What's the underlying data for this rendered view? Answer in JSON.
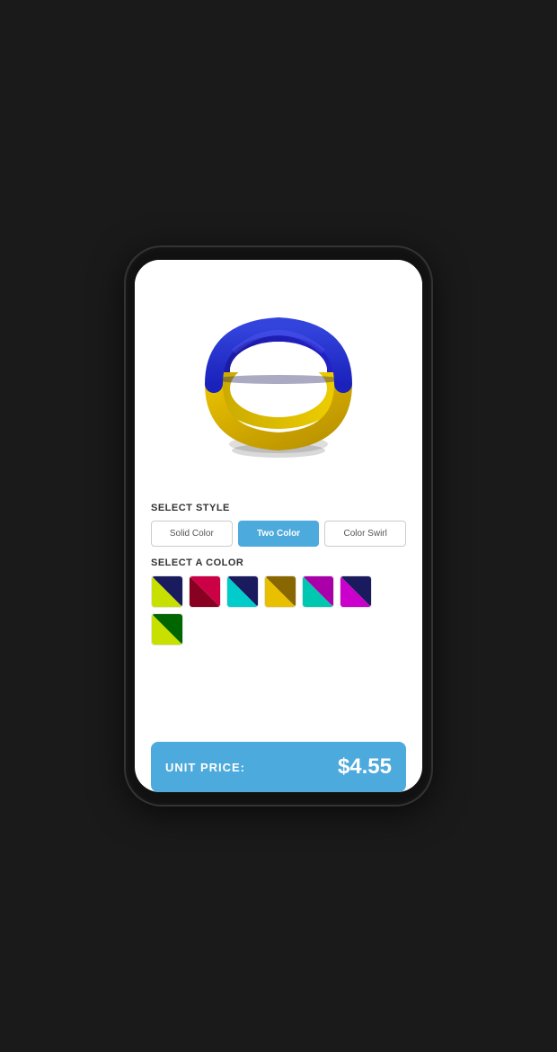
{
  "phone": {
    "screen": {
      "select_style_label": "SELECT STYLE",
      "select_color_label": "SELECT A COLOR",
      "style_buttons": [
        {
          "id": "solid",
          "label": "Solid Color",
          "active": false
        },
        {
          "id": "two",
          "label": "Two Color",
          "active": true
        },
        {
          "id": "swirl",
          "label": "Color Swirl",
          "active": false
        }
      ],
      "color_swatches": [
        {
          "id": "swatch-1",
          "color1": "#c8e000",
          "color2": "#1a1a5e"
        },
        {
          "id": "swatch-2",
          "color1": "#b00030",
          "color2": "#660018"
        },
        {
          "id": "swatch-3",
          "color1": "#00c8c8",
          "color2": "#1a1a5e"
        },
        {
          "id": "swatch-4",
          "color1": "#d4a000",
          "color2": "#7a5000"
        },
        {
          "id": "swatch-5",
          "color1": "#00c8b0",
          "color2": "#aa00aa"
        },
        {
          "id": "swatch-6",
          "color1": "#cc00cc",
          "color2": "#1a1a5e"
        },
        {
          "id": "swatch-7",
          "color1": "#c8e000",
          "color2": "#006600"
        }
      ],
      "price_label": "UNIT PRICE:",
      "price_value": "$4.55"
    }
  }
}
